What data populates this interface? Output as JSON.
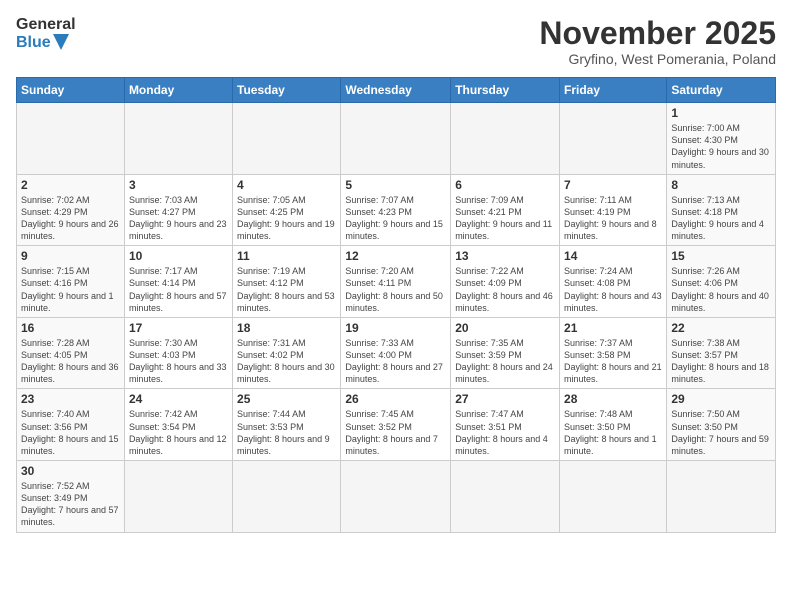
{
  "header": {
    "logo_general": "General",
    "logo_blue": "Blue",
    "month_title": "November 2025",
    "subtitle": "Gryfino, West Pomerania, Poland"
  },
  "weekdays": [
    "Sunday",
    "Monday",
    "Tuesday",
    "Wednesday",
    "Thursday",
    "Friday",
    "Saturday"
  ],
  "weeks": [
    [
      {
        "day": "",
        "info": ""
      },
      {
        "day": "",
        "info": ""
      },
      {
        "day": "",
        "info": ""
      },
      {
        "day": "",
        "info": ""
      },
      {
        "day": "",
        "info": ""
      },
      {
        "day": "",
        "info": ""
      },
      {
        "day": "1",
        "info": "Sunrise: 7:00 AM\nSunset: 4:30 PM\nDaylight: 9 hours and 30 minutes."
      }
    ],
    [
      {
        "day": "2",
        "info": "Sunrise: 7:02 AM\nSunset: 4:29 PM\nDaylight: 9 hours and 26 minutes."
      },
      {
        "day": "3",
        "info": "Sunrise: 7:03 AM\nSunset: 4:27 PM\nDaylight: 9 hours and 23 minutes."
      },
      {
        "day": "4",
        "info": "Sunrise: 7:05 AM\nSunset: 4:25 PM\nDaylight: 9 hours and 19 minutes."
      },
      {
        "day": "5",
        "info": "Sunrise: 7:07 AM\nSunset: 4:23 PM\nDaylight: 9 hours and 15 minutes."
      },
      {
        "day": "6",
        "info": "Sunrise: 7:09 AM\nSunset: 4:21 PM\nDaylight: 9 hours and 11 minutes."
      },
      {
        "day": "7",
        "info": "Sunrise: 7:11 AM\nSunset: 4:19 PM\nDaylight: 9 hours and 8 minutes."
      },
      {
        "day": "8",
        "info": "Sunrise: 7:13 AM\nSunset: 4:18 PM\nDaylight: 9 hours and 4 minutes."
      }
    ],
    [
      {
        "day": "9",
        "info": "Sunrise: 7:15 AM\nSunset: 4:16 PM\nDaylight: 9 hours and 1 minute."
      },
      {
        "day": "10",
        "info": "Sunrise: 7:17 AM\nSunset: 4:14 PM\nDaylight: 8 hours and 57 minutes."
      },
      {
        "day": "11",
        "info": "Sunrise: 7:19 AM\nSunset: 4:12 PM\nDaylight: 8 hours and 53 minutes."
      },
      {
        "day": "12",
        "info": "Sunrise: 7:20 AM\nSunset: 4:11 PM\nDaylight: 8 hours and 50 minutes."
      },
      {
        "day": "13",
        "info": "Sunrise: 7:22 AM\nSunset: 4:09 PM\nDaylight: 8 hours and 46 minutes."
      },
      {
        "day": "14",
        "info": "Sunrise: 7:24 AM\nSunset: 4:08 PM\nDaylight: 8 hours and 43 minutes."
      },
      {
        "day": "15",
        "info": "Sunrise: 7:26 AM\nSunset: 4:06 PM\nDaylight: 8 hours and 40 minutes."
      }
    ],
    [
      {
        "day": "16",
        "info": "Sunrise: 7:28 AM\nSunset: 4:05 PM\nDaylight: 8 hours and 36 minutes."
      },
      {
        "day": "17",
        "info": "Sunrise: 7:30 AM\nSunset: 4:03 PM\nDaylight: 8 hours and 33 minutes."
      },
      {
        "day": "18",
        "info": "Sunrise: 7:31 AM\nSunset: 4:02 PM\nDaylight: 8 hours and 30 minutes."
      },
      {
        "day": "19",
        "info": "Sunrise: 7:33 AM\nSunset: 4:00 PM\nDaylight: 8 hours and 27 minutes."
      },
      {
        "day": "20",
        "info": "Sunrise: 7:35 AM\nSunset: 3:59 PM\nDaylight: 8 hours and 24 minutes."
      },
      {
        "day": "21",
        "info": "Sunrise: 7:37 AM\nSunset: 3:58 PM\nDaylight: 8 hours and 21 minutes."
      },
      {
        "day": "22",
        "info": "Sunrise: 7:38 AM\nSunset: 3:57 PM\nDaylight: 8 hours and 18 minutes."
      }
    ],
    [
      {
        "day": "23",
        "info": "Sunrise: 7:40 AM\nSunset: 3:56 PM\nDaylight: 8 hours and 15 minutes."
      },
      {
        "day": "24",
        "info": "Sunrise: 7:42 AM\nSunset: 3:54 PM\nDaylight: 8 hours and 12 minutes."
      },
      {
        "day": "25",
        "info": "Sunrise: 7:44 AM\nSunset: 3:53 PM\nDaylight: 8 hours and 9 minutes."
      },
      {
        "day": "26",
        "info": "Sunrise: 7:45 AM\nSunset: 3:52 PM\nDaylight: 8 hours and 7 minutes."
      },
      {
        "day": "27",
        "info": "Sunrise: 7:47 AM\nSunset: 3:51 PM\nDaylight: 8 hours and 4 minutes."
      },
      {
        "day": "28",
        "info": "Sunrise: 7:48 AM\nSunset: 3:50 PM\nDaylight: 8 hours and 1 minute."
      },
      {
        "day": "29",
        "info": "Sunrise: 7:50 AM\nSunset: 3:50 PM\nDaylight: 7 hours and 59 minutes."
      }
    ],
    [
      {
        "day": "30",
        "info": "Sunrise: 7:52 AM\nSunset: 3:49 PM\nDaylight: 7 hours and 57 minutes."
      },
      {
        "day": "",
        "info": ""
      },
      {
        "day": "",
        "info": ""
      },
      {
        "day": "",
        "info": ""
      },
      {
        "day": "",
        "info": ""
      },
      {
        "day": "",
        "info": ""
      },
      {
        "day": "",
        "info": ""
      }
    ]
  ]
}
